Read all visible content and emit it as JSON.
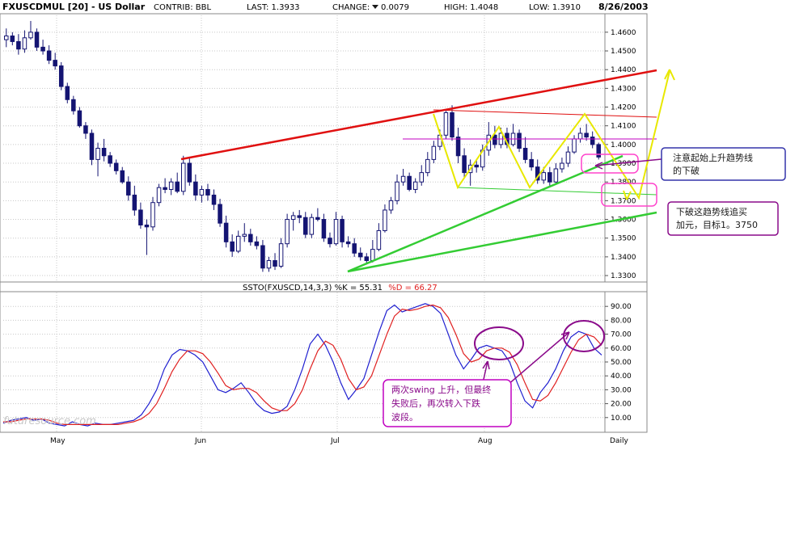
{
  "header": {
    "symbol": "FXUSCDMUL [20] - US Dollar",
    "contrib": "CONTRIB: BBL",
    "last": "LAST: 1.3933",
    "change_label": "CHANGE:",
    "change_value": "0.0079",
    "high": "HIGH: 1.4048",
    "low": "LOW: 1.3910",
    "date": "8/26/2003"
  },
  "indicator_header": {
    "prefix": "SSTO(FXUSCD,14,3,3) %K = 55.31",
    "d_part": "%D = 66.27",
    "k_color": "#1f1fd0",
    "d_color": "#e02020"
  },
  "x_axis": {
    "months": [
      "May",
      "Jun",
      "Jul",
      "Aug"
    ],
    "frequency": "Daily"
  },
  "watermark": "futuresource.com",
  "annotations": {
    "note1": [
      "注意起始上升趋势线",
      "的下破"
    ],
    "note2": [
      "下破这趋势线追买",
      "加元，目标1。3750"
    ],
    "note3": [
      "两次swing 上升，但最终",
      "失败后，再次转入下跌",
      "波段。"
    ]
  },
  "colors": {
    "up_candle": "#ffffff",
    "down_candle": "#141472",
    "red_line": "#e01010",
    "green_line": "#33cc33",
    "yellow_line": "#e8e800",
    "magenta": "#c000c0",
    "grid": "#c8c8c8"
  },
  "chart_data": [
    {
      "type": "candlestick",
      "title": "FXUSCDMUL [20] - US Dollar",
      "y_ticks": [
        "1.4600",
        "1.4500",
        "1.4400",
        "1.4300",
        "1.4200",
        "1.4100",
        "1.4000",
        "1.3900",
        "1.3800",
        "1.3700",
        "1.3600",
        "1.3500",
        "1.3400",
        "1.3300"
      ],
      "ylim": [
        1.327,
        1.469
      ],
      "grid": true,
      "ohlc": [
        [
          1.456,
          1.462,
          1.452,
          1.458
        ],
        [
          1.458,
          1.46,
          1.453,
          1.455
        ],
        [
          1.455,
          1.459,
          1.448,
          1.451
        ],
        [
          1.451,
          1.461,
          1.449,
          1.457
        ],
        [
          1.457,
          1.466,
          1.456,
          1.46
        ],
        [
          1.46,
          1.462,
          1.45,
          1.452
        ],
        [
          1.452,
          1.456,
          1.448,
          1.45
        ],
        [
          1.45,
          1.453,
          1.443,
          1.445
        ],
        [
          1.445,
          1.449,
          1.44,
          1.442
        ],
        [
          1.442,
          1.444,
          1.429,
          1.431
        ],
        [
          1.431,
          1.433,
          1.422,
          1.424
        ],
        [
          1.424,
          1.426,
          1.416,
          1.418
        ],
        [
          1.418,
          1.42,
          1.409,
          1.41
        ],
        [
          1.41,
          1.412,
          1.403,
          1.406
        ],
        [
          1.406,
          1.408,
          1.389,
          1.392
        ],
        [
          1.392,
          1.401,
          1.383,
          1.398
        ],
        [
          1.398,
          1.403,
          1.391,
          1.394
        ],
        [
          1.394,
          1.396,
          1.388,
          1.39
        ],
        [
          1.39,
          1.392,
          1.384,
          1.386
        ],
        [
          1.386,
          1.388,
          1.379,
          1.38
        ],
        [
          1.38,
          1.383,
          1.37,
          1.373
        ],
        [
          1.373,
          1.378,
          1.362,
          1.365
        ],
        [
          1.365,
          1.369,
          1.355,
          1.357
        ],
        [
          1.357,
          1.36,
          1.341,
          1.356
        ],
        [
          1.356,
          1.372,
          1.354,
          1.369
        ],
        [
          1.369,
          1.379,
          1.367,
          1.377
        ],
        [
          1.377,
          1.382,
          1.374,
          1.376
        ],
        [
          1.376,
          1.382,
          1.373,
          1.38
        ],
        [
          1.38,
          1.385,
          1.374,
          1.375
        ],
        [
          1.375,
          1.394,
          1.373,
          1.39
        ],
        [
          1.39,
          1.393,
          1.378,
          1.38
        ],
        [
          1.38,
          1.384,
          1.37,
          1.373
        ],
        [
          1.373,
          1.378,
          1.369,
          1.376
        ],
        [
          1.376,
          1.379,
          1.37,
          1.373
        ],
        [
          1.373,
          1.376,
          1.365,
          1.368
        ],
        [
          1.368,
          1.371,
          1.356,
          1.358
        ],
        [
          1.358,
          1.362,
          1.345,
          1.348
        ],
        [
          1.348,
          1.352,
          1.34,
          1.343
        ],
        [
          1.343,
          1.354,
          1.342,
          1.351
        ],
        [
          1.351,
          1.358,
          1.348,
          1.352
        ],
        [
          1.352,
          1.355,
          1.346,
          1.348
        ],
        [
          1.348,
          1.351,
          1.344,
          1.346
        ],
        [
          1.346,
          1.349,
          1.332,
          1.334
        ],
        [
          1.334,
          1.34,
          1.332,
          1.338
        ],
        [
          1.338,
          1.342,
          1.333,
          1.335
        ],
        [
          1.335,
          1.35,
          1.334,
          1.347
        ],
        [
          1.347,
          1.363,
          1.345,
          1.36
        ],
        [
          1.36,
          1.364,
          1.354,
          1.362
        ],
        [
          1.362,
          1.365,
          1.358,
          1.361
        ],
        [
          1.361,
          1.364,
          1.35,
          1.352
        ],
        [
          1.352,
          1.363,
          1.35,
          1.361
        ],
        [
          1.361,
          1.366,
          1.359,
          1.36
        ],
        [
          1.36,
          1.363,
          1.348,
          1.35
        ],
        [
          1.35,
          1.353,
          1.345,
          1.347
        ],
        [
          1.347,
          1.364,
          1.346,
          1.36
        ],
        [
          1.36,
          1.362,
          1.345,
          1.348
        ],
        [
          1.348,
          1.351,
          1.345,
          1.347
        ],
        [
          1.347,
          1.35,
          1.34,
          1.342
        ],
        [
          1.342,
          1.345,
          1.338,
          1.34
        ],
        [
          1.34,
          1.342,
          1.336,
          1.338
        ],
        [
          1.338,
          1.349,
          1.337,
          1.344
        ],
        [
          1.344,
          1.358,
          1.343,
          1.354
        ],
        [
          1.354,
          1.368,
          1.353,
          1.365
        ],
        [
          1.365,
          1.372,
          1.363,
          1.37
        ],
        [
          1.37,
          1.384,
          1.368,
          1.38
        ],
        [
          1.38,
          1.387,
          1.378,
          1.383
        ],
        [
          1.383,
          1.385,
          1.375,
          1.376
        ],
        [
          1.376,
          1.382,
          1.374,
          1.38
        ],
        [
          1.38,
          1.389,
          1.378,
          1.385
        ],
        [
          1.385,
          1.396,
          1.383,
          1.392
        ],
        [
          1.392,
          1.402,
          1.39,
          1.399
        ],
        [
          1.399,
          1.408,
          1.397,
          1.405
        ],
        [
          1.405,
          1.418,
          1.403,
          1.417
        ],
        [
          1.417,
          1.421,
          1.402,
          1.404
        ],
        [
          1.404,
          1.409,
          1.39,
          1.394
        ],
        [
          1.394,
          1.398,
          1.382,
          1.385
        ],
        [
          1.385,
          1.392,
          1.378,
          1.389
        ],
        [
          1.389,
          1.392,
          1.385,
          1.388
        ],
        [
          1.388,
          1.4,
          1.386,
          1.397
        ],
        [
          1.397,
          1.412,
          1.394,
          1.405
        ],
        [
          1.405,
          1.41,
          1.398,
          1.4
        ],
        [
          1.4,
          1.409,
          1.398,
          1.406
        ],
        [
          1.406,
          1.409,
          1.398,
          1.4
        ],
        [
          1.4,
          1.411,
          1.399,
          1.406
        ],
        [
          1.406,
          1.408,
          1.396,
          1.398
        ],
        [
          1.398,
          1.404,
          1.39,
          1.392
        ],
        [
          1.392,
          1.396,
          1.386,
          1.388
        ],
        [
          1.388,
          1.392,
          1.379,
          1.381
        ],
        [
          1.381,
          1.388,
          1.379,
          1.385
        ],
        [
          1.385,
          1.388,
          1.378,
          1.38
        ],
        [
          1.38,
          1.39,
          1.379,
          1.387
        ],
        [
          1.387,
          1.393,
          1.385,
          1.39
        ],
        [
          1.39,
          1.399,
          1.388,
          1.396
        ],
        [
          1.396,
          1.405,
          1.395,
          1.403
        ],
        [
          1.403,
          1.409,
          1.401,
          1.406
        ],
        [
          1.406,
          1.411,
          1.402,
          1.404
        ],
        [
          1.404,
          1.407,
          1.398,
          1.4
        ],
        [
          1.4,
          1.401,
          1.392,
          1.3933
        ]
      ]
    },
    {
      "type": "line",
      "title": "SSTO(FXUSCD,14,3,3)",
      "y_ticks": [
        "90.00",
        "80.00",
        "70.00",
        "60.00",
        "50.00",
        "40.00",
        "30.00",
        "20.00",
        "10.00"
      ],
      "ylim": [
        0,
        100
      ],
      "series": [
        {
          "name": "%K",
          "color": "#1f1fd0",
          "values": [
            6,
            8,
            9,
            10,
            8,
            9,
            6,
            5,
            4,
            7,
            5,
            4,
            6,
            5,
            5,
            6,
            7,
            8,
            12,
            20,
            30,
            45,
            55,
            59,
            58,
            55,
            50,
            40,
            30,
            28,
            31,
            35,
            28,
            20,
            15,
            13,
            14,
            18,
            30,
            45,
            63,
            70,
            62,
            50,
            35,
            23,
            30,
            38,
            55,
            72,
            87,
            91,
            86,
            88,
            90,
            92,
            90,
            85,
            70,
            55,
            45,
            52,
            60,
            62,
            60,
            58,
            50,
            35,
            22,
            17,
            28,
            35,
            45,
            58,
            68,
            72,
            70,
            60,
            55
          ]
        },
        {
          "name": "%D",
          "color": "#e02020",
          "values": [
            7,
            7,
            8,
            9,
            9,
            9,
            8,
            6,
            5,
            5,
            5,
            5,
            5,
            5,
            5,
            5,
            6,
            7,
            9,
            13,
            20,
            31,
            43,
            52,
            58,
            58,
            56,
            50,
            42,
            33,
            30,
            31,
            31,
            28,
            22,
            17,
            15,
            15,
            20,
            30,
            45,
            58,
            65,
            62,
            52,
            38,
            30,
            32,
            40,
            55,
            70,
            83,
            88,
            87,
            88,
            90,
            91,
            89,
            82,
            70,
            56,
            50,
            52,
            58,
            60,
            60,
            57,
            48,
            35,
            23,
            22,
            26,
            35,
            46,
            57,
            66,
            70,
            68,
            62
          ]
        }
      ]
    }
  ]
}
